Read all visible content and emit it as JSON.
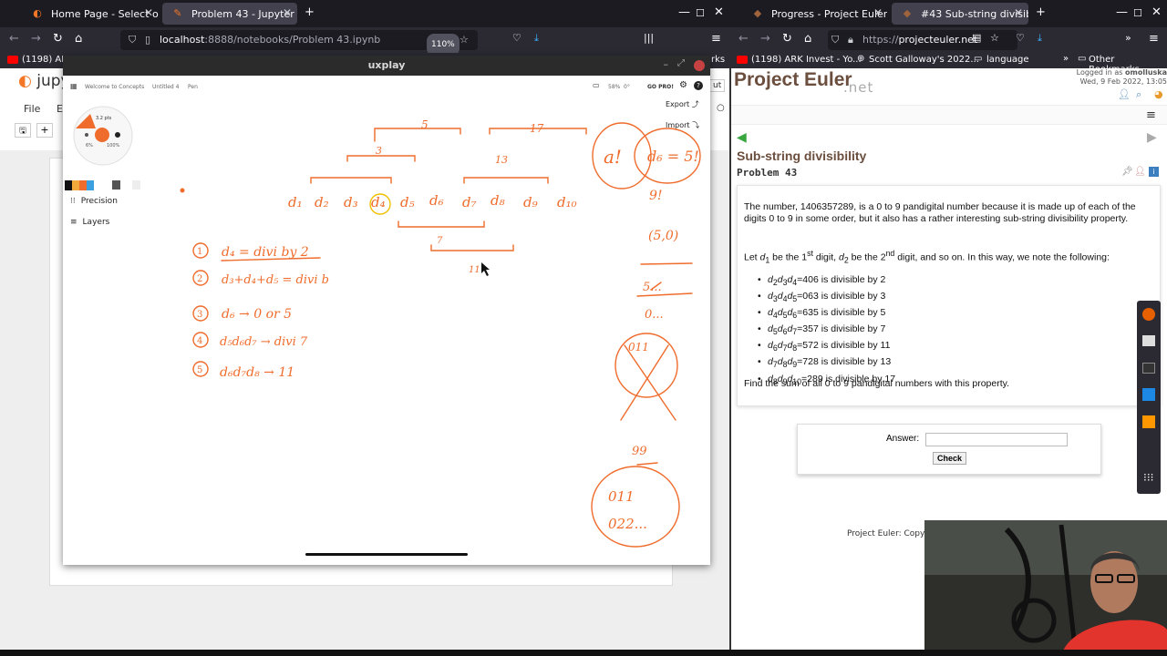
{
  "left_browser": {
    "tabs": [
      {
        "label": "Home Page - Select or cr",
        "active": false
      },
      {
        "label": "Problem 43 - Jupyter Not",
        "active": true
      }
    ],
    "url": "localhost:8888/notebooks/Problem 43.ipynb",
    "url_host": "localhost",
    "url_rest": ":8888/notebooks/Problem 43.ipynb",
    "zoom": "110%",
    "bookmark": "(1198) ARK",
    "bookmark_suffix": "rks",
    "jupyter": {
      "logo": "jupyte",
      "menu_file": "File",
      "menu_e": "E",
      "logout": "ut"
    }
  },
  "uxplay": {
    "title": "uxplay",
    "concepts": {
      "breadcrumb_home": "Welcome to Concepts",
      "breadcrumb_doc": "Untitled 4",
      "breadcrumb_tool": "Pen",
      "zoom": "58%",
      "angle": "0°",
      "go_pro": "GO PRO!",
      "export": "Export",
      "import": "Import",
      "precision": "Precision",
      "layers": "Layers",
      "brush_size": "3.2 pts",
      "opacity_left": "6%",
      "opacity_right": "100%"
    },
    "notes": {
      "d_labels": [
        "d₁",
        "d₂",
        "d₃",
        "d₄",
        "d₅",
        "d₆",
        "d₇",
        "d₈",
        "d₉",
        "d₁₀"
      ],
      "brackets": [
        "5",
        "17",
        "3",
        "13",
        "7",
        "11"
      ],
      "rules": [
        {
          "n": "1",
          "text": "d₄ = divi by 2"
        },
        {
          "n": "2",
          "text": "d₃+d₄+d₅ = divi b"
        },
        {
          "n": "3",
          "text": "d₆ → 0 or 5"
        },
        {
          "n": "4",
          "text": "d₅d₆d₇ → divi 7"
        },
        {
          "n": "5",
          "text": "d₆d₇d₈ → 11"
        }
      ],
      "right_notes": [
        "a!",
        "d₆ = 5!",
        "9!",
        "(5,0)",
        "5...",
        "0...",
        "011",
        "99",
        "011",
        "022..."
      ]
    }
  },
  "right_browser": {
    "tabs": [
      {
        "label": "Progress - Project Euler",
        "active": false
      },
      {
        "label": "#43 Sub-string divisibility",
        "active": true
      }
    ],
    "url": "https://projecteuler.net",
    "url_scheme": "https://",
    "url_host": "projecteuler.net",
    "bookmarks": [
      "(1198) ARK Invest - Yo...",
      "Scott Galloway's 2022...",
      "language",
      "Other Bookmarks"
    ],
    "page": {
      "logo": "Project Euler",
      "logo_net": ".net",
      "logged_in": "Logged in as",
      "username": "omolluska",
      "date": "Wed, 9 Feb 2022, 13:05",
      "title": "Sub-string divisibility",
      "problem": "Problem 43",
      "intro": "The number, 1406357289, is a 0 to 9 pandigital number because it is made up of each of the digits 0 to 9 in some order, but it also has a rather interesting sub-string divisibility property.",
      "let_prefix": "Let",
      "let_d1": "d",
      "let_mid1": "be the 1",
      "st": "st",
      "let_mid2": "digit,",
      "let_mid3": "be the 2",
      "nd": "nd",
      "let_end": "digit, and so on. In this way, we note the following:",
      "properties": [
        {
          "sub": [
            "2",
            "3",
            "4"
          ],
          "value": "406",
          "div": "2"
        },
        {
          "sub": [
            "3",
            "4",
            "5"
          ],
          "value": "063",
          "div": "3"
        },
        {
          "sub": [
            "4",
            "5",
            "6"
          ],
          "value": "635",
          "div": "5"
        },
        {
          "sub": [
            "5",
            "6",
            "7"
          ],
          "value": "357",
          "div": "7"
        },
        {
          "sub": [
            "6",
            "7",
            "8"
          ],
          "value": "572",
          "div": "11"
        },
        {
          "sub": [
            "7",
            "8",
            "9"
          ],
          "value": "728",
          "div": "13"
        },
        {
          "sub": [
            "8",
            "9",
            "10"
          ],
          "value": "289",
          "div": "17"
        }
      ],
      "is_divisible_by": "is divisible by",
      "question": "Find the sum of all 0 to 9 pandigital numbers with this property.",
      "answer_label": "Answer:",
      "check_label": "Check",
      "copyright": "Project Euler: Copyri"
    }
  },
  "colors": {
    "firefox_dark": "#1c1b22",
    "firefox_toolbar": "#2b2a33",
    "ink_orange": "#ef6c2c",
    "pe_brown": "#6b4e3d"
  }
}
